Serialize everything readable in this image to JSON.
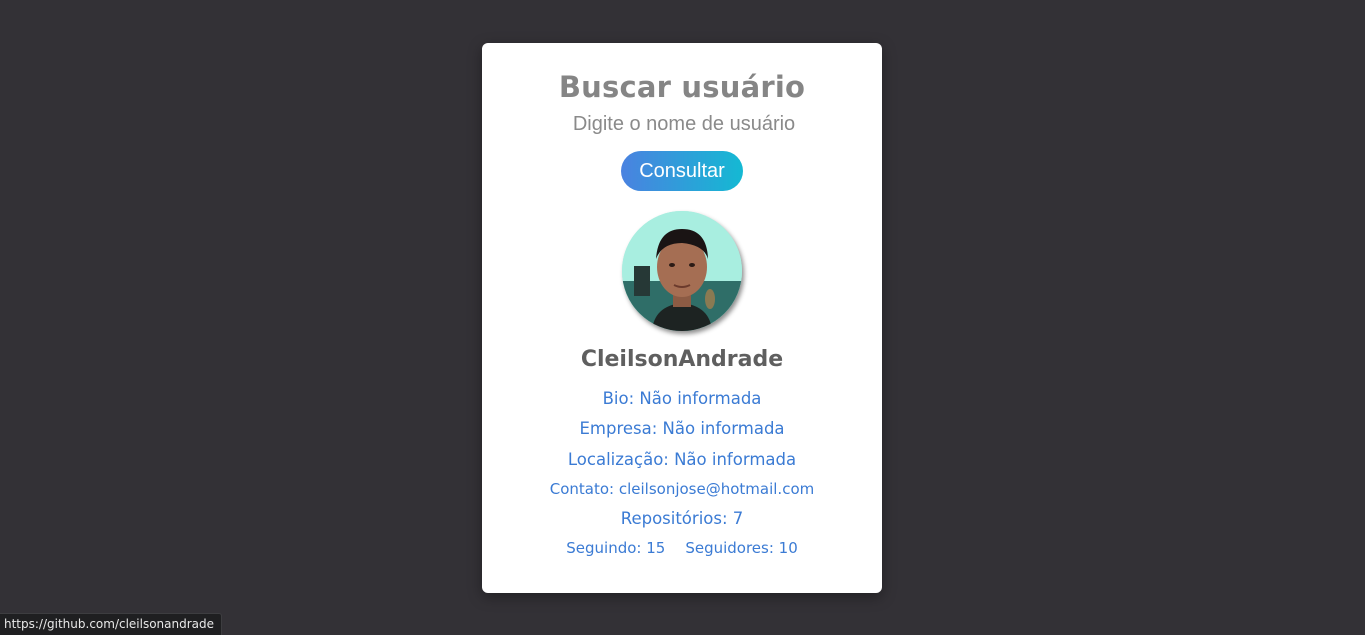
{
  "search": {
    "title": "Buscar usuário",
    "placeholder": "Digite o nome de usuário",
    "value": "",
    "button_label": "Consultar"
  },
  "profile": {
    "avatar_icon": "user-avatar-photo",
    "username": "CleilsonAndrade",
    "bio": "Bio: Não informada",
    "company": "Empresa: Não informada",
    "location": "Localização: Não informada",
    "contact": "Contato: cleilsonjose@hotmail.com",
    "repositories": "Repositórios: 7",
    "following": "Seguindo: 15",
    "followers": "Seguidores: 10"
  },
  "status_bar": {
    "url": "https://github.com/cleilsonandrade"
  },
  "colors": {
    "background": "#333136",
    "card": "#ffffff",
    "accent_link": "#3b7bd4",
    "button_gradient_start": "#4a82e0",
    "button_gradient_end": "#14b9d3"
  }
}
